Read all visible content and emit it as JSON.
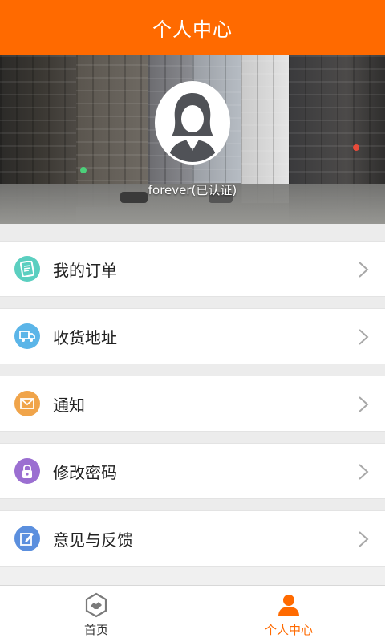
{
  "header": {
    "title": "个人中心"
  },
  "profile": {
    "username": "forever(已认证)"
  },
  "menu": {
    "items": [
      {
        "label": "我的订单",
        "icon": "order-document-icon",
        "color": "#5bcfc0"
      },
      {
        "label": "收货地址",
        "icon": "delivery-truck-icon",
        "color": "#5bb5e8"
      },
      {
        "label": "通知",
        "icon": "envelope-icon",
        "color": "#f0a44a"
      },
      {
        "label": "修改密码",
        "icon": "lock-icon",
        "color": "#9b6fd1"
      },
      {
        "label": "意见与反馈",
        "icon": "edit-pencil-icon",
        "color": "#5b8fde"
      }
    ]
  },
  "tabbar": {
    "tabs": [
      {
        "label": "首页",
        "icon": "home-handshake-icon",
        "active": false
      },
      {
        "label": "个人中心",
        "icon": "person-icon",
        "active": true
      }
    ],
    "active_color": "#ff6a00"
  },
  "colors": {
    "brand": "#ff6a00"
  }
}
